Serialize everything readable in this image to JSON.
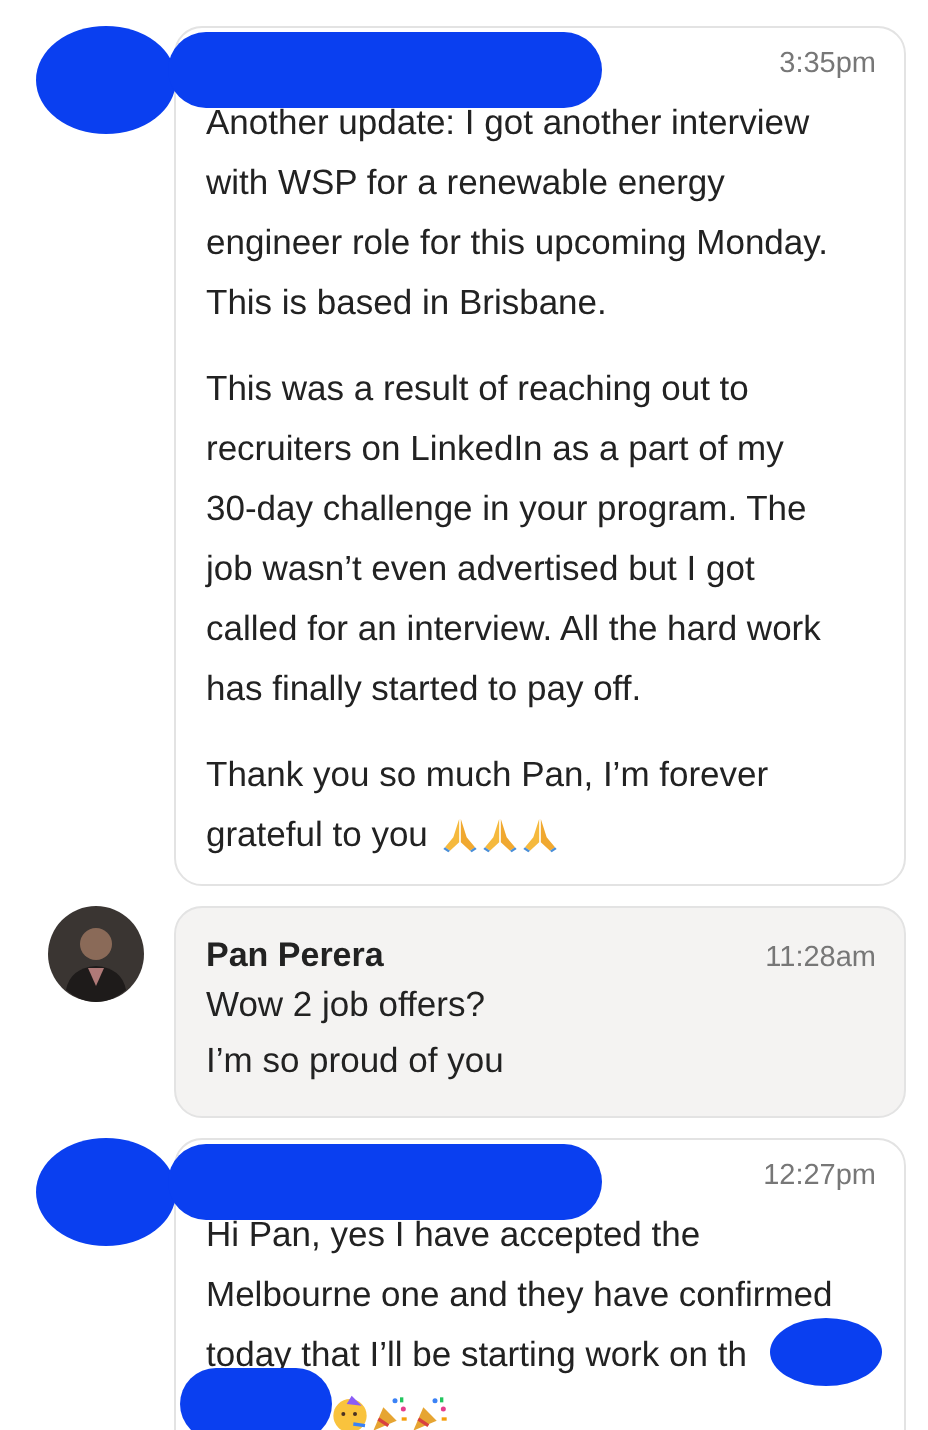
{
  "messages": [
    {
      "kind": "own",
      "time": "3:35pm",
      "paragraphs": [
        {
          "lines": [
            "Another update: I got another interview",
            "with WSP for a renewable energy",
            "engineer role for this upcoming Monday.",
            "This is based in Brisbane."
          ]
        },
        {
          "lines": [
            "This was a result of reaching out to",
            "recruiters on LinkedIn as a part of my",
            "30-day challenge in your program. The",
            "job wasn’t even advertised but I got",
            "called for an interview. All the hard work",
            "has finally started to pay off."
          ]
        },
        {
          "lines": [
            "Thank you so much Pan, I’m forever",
            "grateful to you"
          ],
          "emoji": [
            {
              "kind": "pray"
            },
            {
              "kind": "pray"
            },
            {
              "kind": "pray"
            }
          ]
        }
      ]
    },
    {
      "kind": "contact",
      "sender": "Pan Perera",
      "time": "11:28am",
      "paragraphs": [
        {
          "lines": [
            "Wow 2 job offers?",
            "I’m so proud of you"
          ]
        }
      ]
    },
    {
      "kind": "own",
      "time": "12:27pm",
      "paragraphs": [
        {
          "lines": [
            "Hi Pan, yes I have accepted the",
            "Melbourne one and they have confirmed",
            "today that I’ll be starting work on th"
          ],
          "emoji_line": [
            {
              "kind": "party-face"
            },
            {
              "kind": "party-popper"
            },
            {
              "kind": "party-popper"
            }
          ]
        }
      ]
    }
  ]
}
